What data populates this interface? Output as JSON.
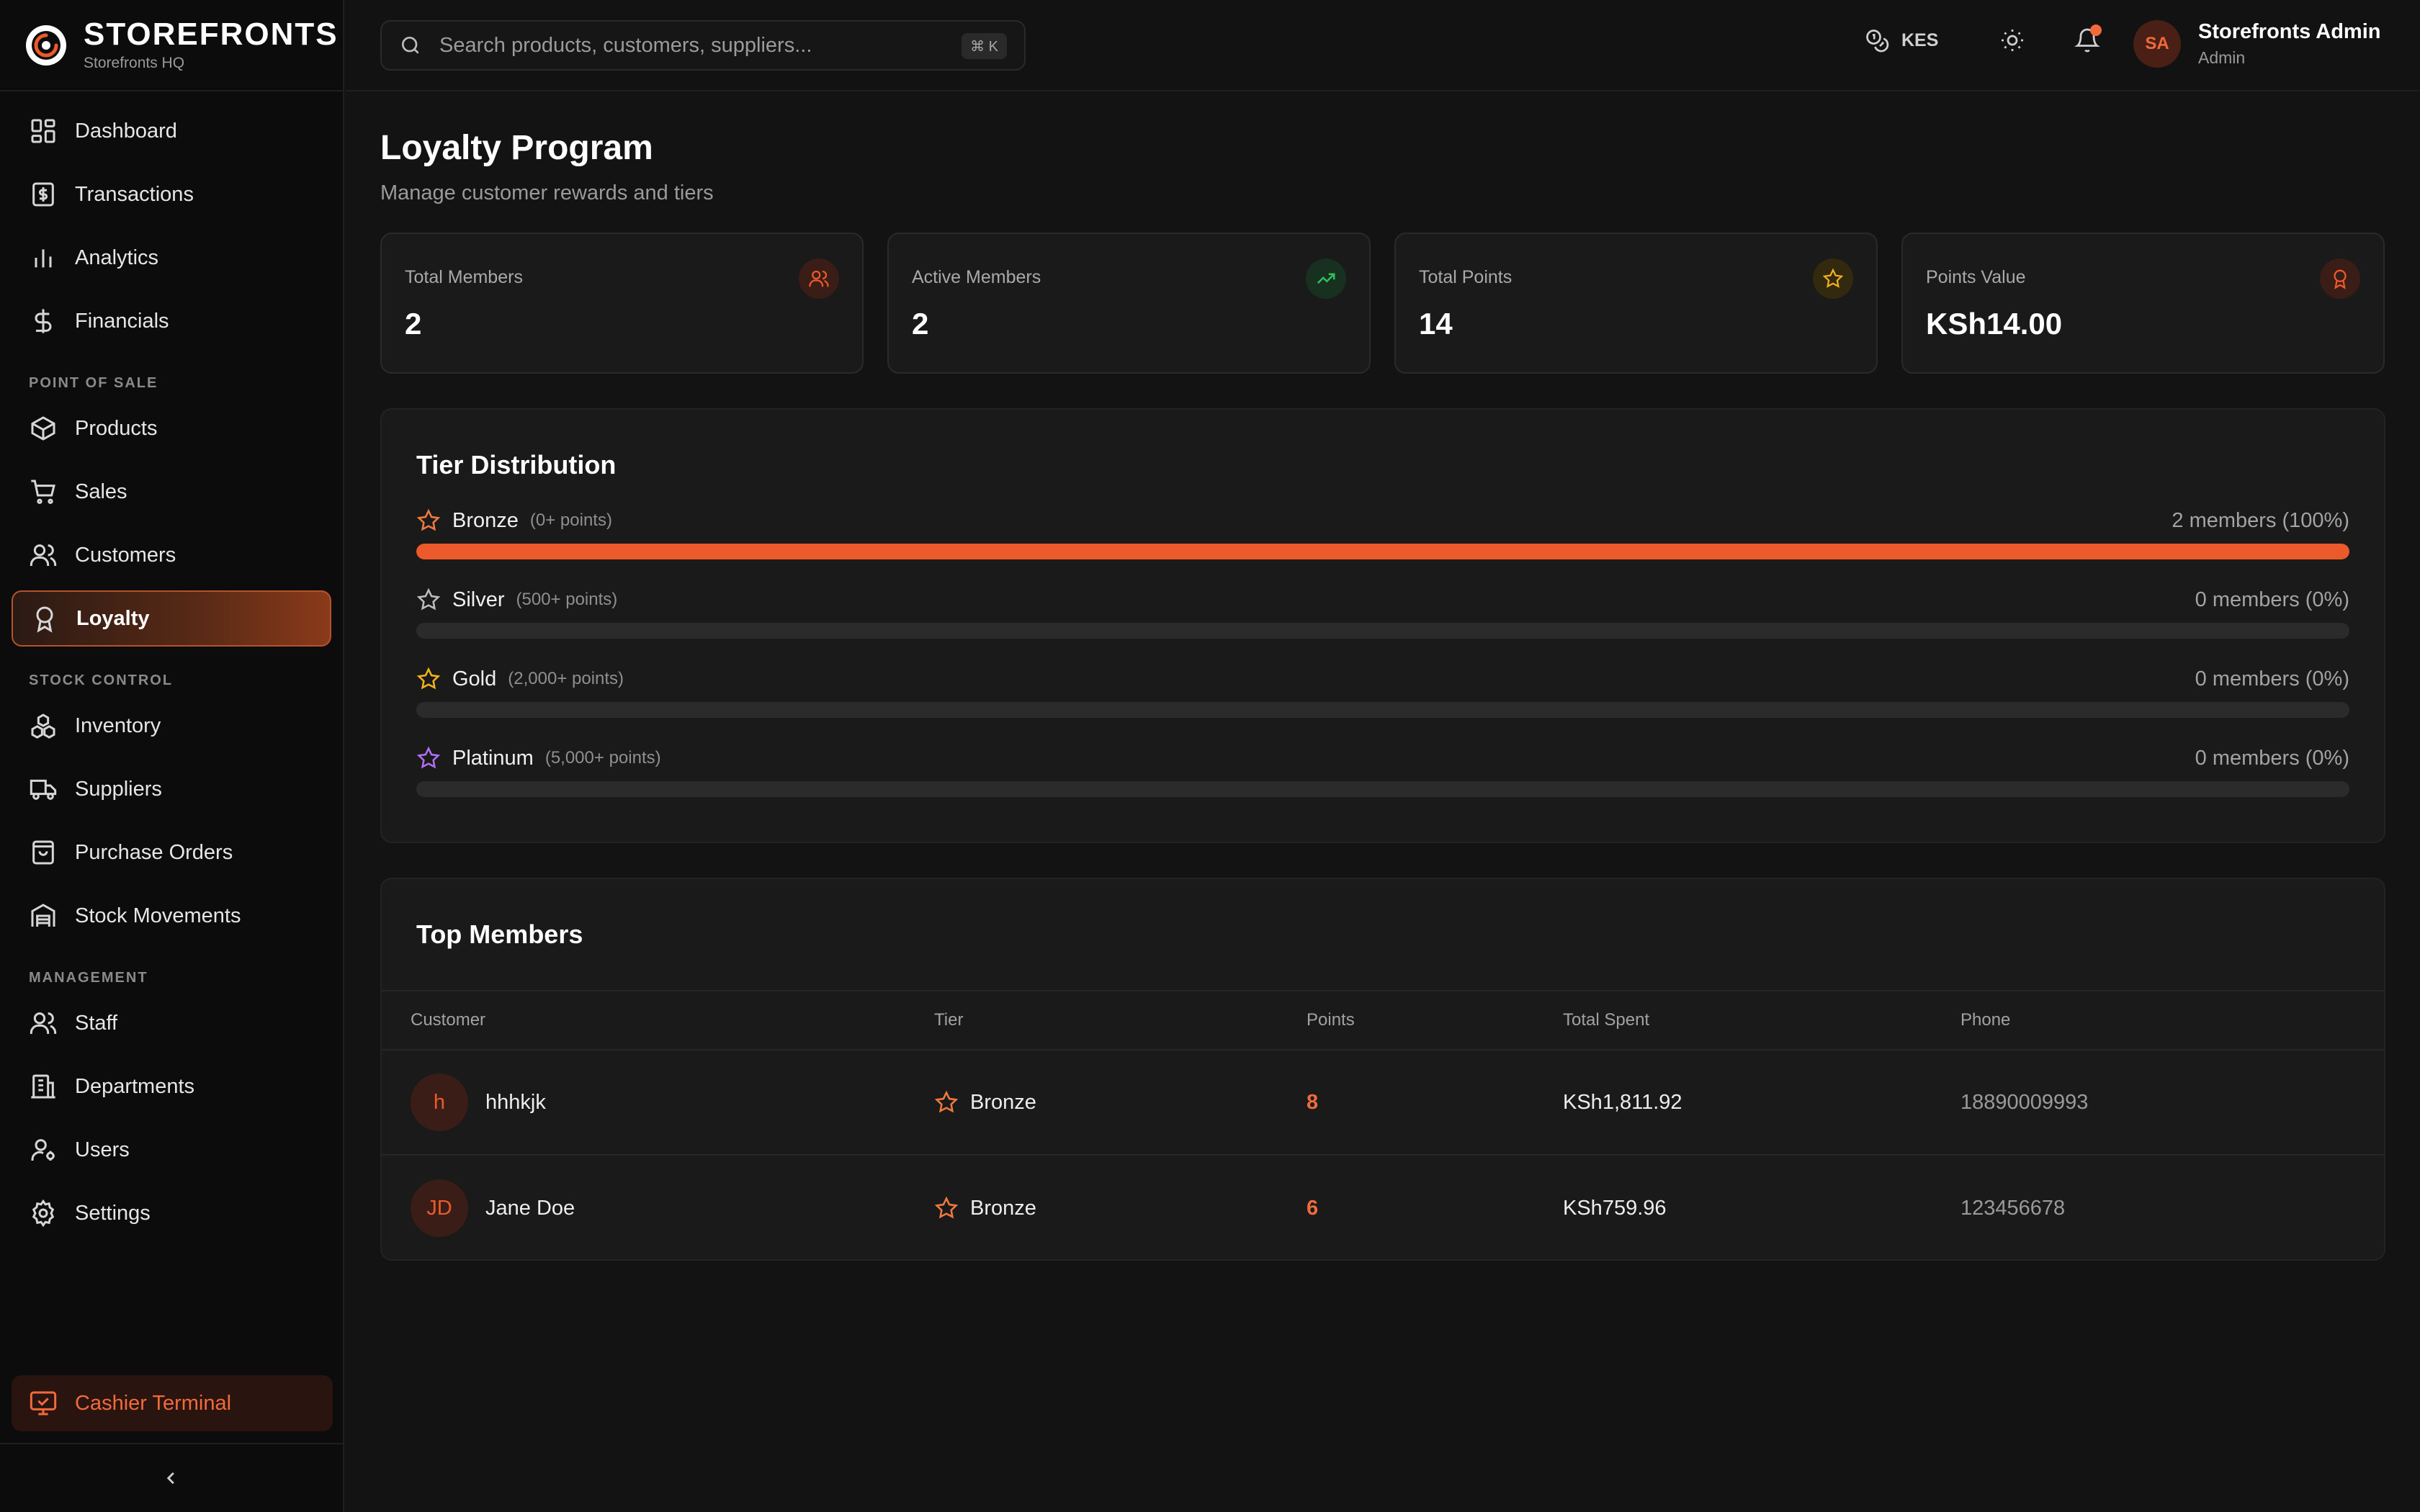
{
  "brand": {
    "title": "STOREFRONTS",
    "subtitle": "Storefronts HQ"
  },
  "sidebar": {
    "top_items": [
      {
        "label": "Dashboard",
        "icon": "dashboard-icon"
      },
      {
        "label": "Transactions",
        "icon": "dollar-receipt-icon"
      },
      {
        "label": "Analytics",
        "icon": "bar-chart-icon"
      },
      {
        "label": "Financials",
        "icon": "dollar-icon"
      }
    ],
    "section_pos": "POINT OF SALE",
    "pos_items": [
      {
        "label": "Products",
        "icon": "box-icon"
      },
      {
        "label": "Sales",
        "icon": "cart-icon"
      },
      {
        "label": "Customers",
        "icon": "users-icon"
      },
      {
        "label": "Loyalty",
        "icon": "award-icon",
        "active": true
      }
    ],
    "section_stock": "STOCK CONTROL",
    "stock_items": [
      {
        "label": "Inventory",
        "icon": "boxes-icon"
      },
      {
        "label": "Suppliers",
        "icon": "truck-icon"
      },
      {
        "label": "Purchase Orders",
        "icon": "shopping-bag-icon"
      },
      {
        "label": "Stock Movements",
        "icon": "warehouse-icon"
      }
    ],
    "section_mgmt": "MANAGEMENT",
    "mgmt_items": [
      {
        "label": "Staff",
        "icon": "users-icon"
      },
      {
        "label": "Departments",
        "icon": "building-icon"
      },
      {
        "label": "Users",
        "icon": "user-cog-icon"
      },
      {
        "label": "Settings",
        "icon": "gear-icon"
      }
    ],
    "cashier_label": "Cashier Terminal"
  },
  "header": {
    "search_placeholder": "Search products, customers, suppliers...",
    "shortcut": "⌘ K",
    "currency": "KES",
    "user_initials": "SA",
    "user_name": "Storefronts Admin",
    "user_role": "Admin"
  },
  "page": {
    "title": "Loyalty Program",
    "subtitle": "Manage customer rewards and tiers"
  },
  "stats": [
    {
      "label": "Total Members",
      "value": "2",
      "icon": "users-icon",
      "color": "#ec5a2c"
    },
    {
      "label": "Active Members",
      "value": "2",
      "icon": "trending-up-icon",
      "color": "#2fbf5a"
    },
    {
      "label": "Total Points",
      "value": "14",
      "icon": "star-icon",
      "color": "#f2b21c"
    },
    {
      "label": "Points Value",
      "value": "KSh14.00",
      "icon": "award-icon",
      "color": "#ec5a2c"
    }
  ],
  "tiers": {
    "title": "Tier Distribution",
    "items": [
      {
        "name": "Bronze",
        "req": "(0+ points)",
        "count": "2 members (100%)",
        "fraction": 1.0,
        "color": "#f07a3e"
      },
      {
        "name": "Silver",
        "req": "(500+ points)",
        "count": "0 members (0%)",
        "fraction": 0.0,
        "color": "#bdbdbd"
      },
      {
        "name": "Gold",
        "req": "(2,000+ points)",
        "count": "0 members (0%)",
        "fraction": 0.0,
        "color": "#f2b21c"
      },
      {
        "name": "Platinum",
        "req": "(5,000+ points)",
        "count": "0 members (0%)",
        "fraction": 0.0,
        "color": "#b06ef0"
      }
    ]
  },
  "members": {
    "title": "Top Members",
    "columns": [
      "Customer",
      "Tier",
      "Points",
      "Total Spent",
      "Phone"
    ],
    "rows": [
      {
        "initials": "h",
        "name": "hhhkjk",
        "tier": "Bronze",
        "points": "8",
        "spent": "KSh1,811.92",
        "phone": "18890009993"
      },
      {
        "initials": "JD",
        "name": "Jane Doe",
        "tier": "Bronze",
        "points": "6",
        "spent": "KSh759.96",
        "phone": "123456678"
      }
    ]
  }
}
